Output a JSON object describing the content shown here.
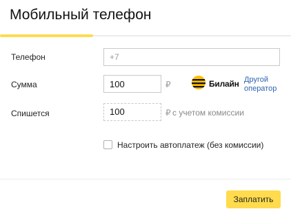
{
  "title": "Мобильный телефон",
  "progress": {
    "fraction": 0.32,
    "color": "#ffdb4d"
  },
  "form": {
    "phone": {
      "label": "Телефон",
      "placeholder": "+7",
      "value": ""
    },
    "amount": {
      "label": "Сумма",
      "value": "100",
      "currency": "₽"
    },
    "charged": {
      "label": "Спишется",
      "value": "100",
      "currency": "₽",
      "note": "с учетом комиссии"
    }
  },
  "operator": {
    "name": "Билайн",
    "logo_icon": "beeline-logo-icon",
    "logo_colors": [
      "#ffc000",
      "#111111"
    ],
    "change_link": "Другой оператор"
  },
  "autopay": {
    "label": "Настроить автоплатеж (без комиссии)",
    "checked": false
  },
  "footer": {
    "pay_button": "Заплатить",
    "pay_button_color": "#ffdb4d"
  },
  "colors": {
    "accent": "#ffdb4d",
    "link": "#2e64b0"
  }
}
